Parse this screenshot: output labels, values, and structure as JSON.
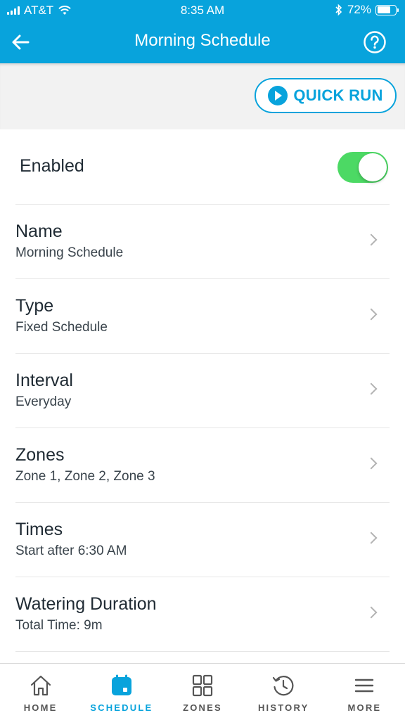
{
  "status_bar": {
    "carrier": "AT&T",
    "time": "8:35 AM",
    "battery": "72%",
    "battery_level": 0.72
  },
  "nav": {
    "title": "Morning Schedule",
    "back_icon": "arrow-left-icon",
    "help_icon": "question-circle-icon"
  },
  "quick_run": {
    "label": "QUICK RUN",
    "icon": "play-circle-icon"
  },
  "enabled": {
    "label": "Enabled",
    "on": true
  },
  "rows": [
    {
      "title": "Name",
      "subtitle": "Morning Schedule"
    },
    {
      "title": "Type",
      "subtitle": "Fixed Schedule"
    },
    {
      "title": "Interval",
      "subtitle": "Everyday"
    },
    {
      "title": "Zones",
      "subtitle": "Zone 1, Zone 2, Zone 3"
    },
    {
      "title": "Times",
      "subtitle": "Start after 6:30 AM"
    },
    {
      "title": "Watering Duration",
      "subtitle": "Total Time: 9m"
    }
  ],
  "tabs": [
    {
      "label": "HOME",
      "icon": "home-icon"
    },
    {
      "label": "SCHEDULE",
      "icon": "calendar-icon",
      "active": true
    },
    {
      "label": "ZONES",
      "icon": "grid-icon"
    },
    {
      "label": "HISTORY",
      "icon": "history-icon"
    },
    {
      "label": "MORE",
      "icon": "menu-icon"
    }
  ],
  "colors": {
    "brand": "#08a3dc",
    "toggle_on": "#4cd964",
    "tab_inactive": "#555555"
  }
}
